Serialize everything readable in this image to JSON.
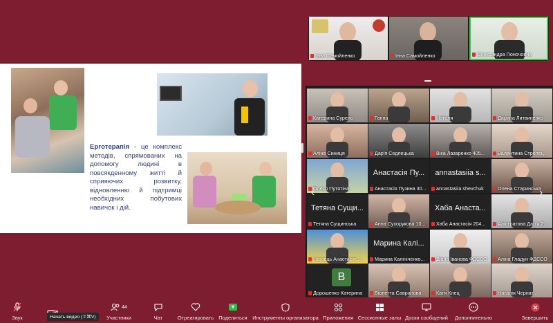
{
  "slide": {
    "term": "Ерготерапія",
    "definition": " - це комплекс методів, спрямованих на допомогу людині в повсякденному житті й сприяючих розвитку, відновленню й підтримці необхідних побутових навичок і дій."
  },
  "top_participants": [
    {
      "name": "Інна Самойленко"
    },
    {
      "name": "Інна Самойленко"
    },
    {
      "name": "Олександра Поночовна"
    }
  ],
  "grid_participants": [
    {
      "name": "Катерина Сурело",
      "video": true
    },
    {
      "name": "Ганна",
      "video": true
    },
    {
      "name": "Наталя",
      "video": true
    },
    {
      "name": "Дарина Литвиненко",
      "video": true
    },
    {
      "name": "Аліна Синиця",
      "video": true
    },
    {
      "name": "Дар'я Седлецька",
      "video": true
    },
    {
      "name": "Віка Лазаренко 405...",
      "video": true
    },
    {
      "name": "Валентина Стрелец...",
      "video": true
    },
    {
      "name": "Олеся Путятіна",
      "video": true
    },
    {
      "name": "Анастасія Пузина 30...",
      "video": false,
      "display": "Анастасія Пу..."
    },
    {
      "name": "annastasiia shevchuk",
      "video": false,
      "display": "annastasiia s..."
    },
    {
      "name": "Олена Старинська",
      "video": true
    },
    {
      "name": "Тетяна Сущинська",
      "video": false,
      "display": "Тетяна Сущи..."
    },
    {
      "name": "Анна Сухорукова 10...",
      "video": true
    },
    {
      "name": "Хаба Анастасія 204...",
      "video": false,
      "display": "Хаба Анаста..."
    },
    {
      "name": "Аліcтратова Дар'я 2...",
      "video": true
    },
    {
      "name": "Нагаєць Анастасія 1...",
      "video": true
    },
    {
      "name": "Марина Калініченко...",
      "video": false,
      "display": "Марина Калі..."
    },
    {
      "name": "Діана Іванова ФДССО",
      "video": true
    },
    {
      "name": "Аліна Гладун ФДССО",
      "video": true
    },
    {
      "name": "Дорошенко Катерина",
      "video": false,
      "avatar": "B"
    },
    {
      "name": "Віолетта Саврaнова",
      "video": true
    },
    {
      "name": "Катя Клец",
      "video": true
    },
    {
      "name": "Наталія Чернат",
      "video": true
    }
  ],
  "toolbar": {
    "audio": "Звук",
    "video_tooltip": "Начать видео (⇧⌘V)",
    "participants": "Участники",
    "participants_count": "44",
    "chat": "Чат",
    "react": "Отреагировать",
    "share": "Поделиться",
    "host_tools": "Инструменты организатора",
    "apps": "Приложения",
    "breakout": "Сессионные залы",
    "whiteboards": "Доски сообщений",
    "more": "Дополнительно",
    "end": "Завершить"
  },
  "colors": {
    "background": "#7d1d2f",
    "share_green": "#2dbb4a",
    "end_red": "#e03c3c",
    "muted_red": "#e02f2f"
  }
}
